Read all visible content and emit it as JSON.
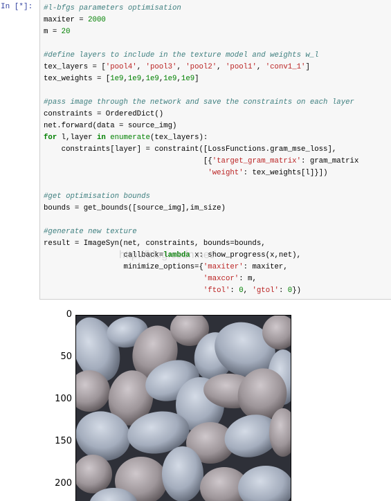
{
  "prompt": "In  [*]:",
  "watermark": "http://blog.csdn.net/",
  "code_lines": [
    [
      [
        "c",
        "#l-bfgs parameters optimisation"
      ]
    ],
    [
      [
        "p",
        "maxiter = "
      ],
      [
        "n",
        "2000"
      ]
    ],
    [
      [
        "p",
        "m = "
      ],
      [
        "n",
        "20"
      ]
    ],
    [],
    [
      [
        "c",
        "#define layers to include in the texture model and weights w_l"
      ]
    ],
    [
      [
        "p",
        "tex_layers = ["
      ],
      [
        "s",
        "'pool4'"
      ],
      [
        "p",
        ", "
      ],
      [
        "s",
        "'pool3'"
      ],
      [
        "p",
        ", "
      ],
      [
        "s",
        "'pool2'"
      ],
      [
        "p",
        ", "
      ],
      [
        "s",
        "'pool1'"
      ],
      [
        "p",
        ", "
      ],
      [
        "s",
        "'conv1_1'"
      ],
      [
        "p",
        "]"
      ]
    ],
    [
      [
        "p",
        "tex_weights = ["
      ],
      [
        "n",
        "1e9"
      ],
      [
        "p",
        ","
      ],
      [
        "n",
        "1e9"
      ],
      [
        "p",
        ","
      ],
      [
        "n",
        "1e9"
      ],
      [
        "p",
        ","
      ],
      [
        "n",
        "1e9"
      ],
      [
        "p",
        ","
      ],
      [
        "n",
        "1e9"
      ],
      [
        "p",
        "]"
      ]
    ],
    [],
    [
      [
        "c",
        "#pass image through the network and save the constraints on each layer"
      ]
    ],
    [
      [
        "p",
        "constraints = OrderedDict()"
      ]
    ],
    [
      [
        "p",
        "net.forward(data = source_img)"
      ]
    ],
    [
      [
        "k",
        "for"
      ],
      [
        "p",
        " l,layer "
      ],
      [
        "k",
        "in"
      ],
      [
        "p",
        " "
      ],
      [
        "n",
        "enumerate"
      ],
      [
        "p",
        "(tex_layers):"
      ]
    ],
    [
      [
        "p",
        "    constraints[layer] = constraint([LossFunctions.gram_mse_loss],"
      ]
    ],
    [
      [
        "p",
        "                                    [{"
      ],
      [
        "s",
        "'target_gram_matrix'"
      ],
      [
        "p",
        ": gram_matrix"
      ]
    ],
    [
      [
        "p",
        "                                     "
      ],
      [
        "s",
        "'weight'"
      ],
      [
        "p",
        ": tex_weights[l]}])"
      ]
    ],
    [],
    [
      [
        "c",
        "#get optimisation bounds"
      ]
    ],
    [
      [
        "p",
        "bounds = get_bounds([source_img],im_size)"
      ]
    ],
    [],
    [
      [
        "c",
        "#generate new texture"
      ]
    ],
    [
      [
        "p",
        "result = ImageSyn(net, constraints, bounds=bounds,"
      ]
    ],
    [
      [
        "p",
        "                  callback="
      ],
      [
        "k",
        "lambda"
      ],
      [
        "p",
        " x: show_progress(x,net),"
      ]
    ],
    [
      [
        "p",
        "                  minimize_options={"
      ],
      [
        "s",
        "'maxiter'"
      ],
      [
        "p",
        ": maxiter,"
      ]
    ],
    [
      [
        "p",
        "                                    "
      ],
      [
        "s",
        "'maxcor'"
      ],
      [
        "p",
        ": m,"
      ]
    ],
    [
      [
        "p",
        "                                    "
      ],
      [
        "s",
        "'ftol'"
      ],
      [
        "p",
        ": "
      ],
      [
        "n",
        "0"
      ],
      [
        "p",
        ", "
      ],
      [
        "s",
        "'gtol'"
      ],
      [
        "p",
        ": "
      ],
      [
        "n",
        "0"
      ],
      [
        "p",
        "})"
      ]
    ]
  ],
  "output_plot": {
    "type": "image",
    "y_ticks": [
      "0",
      "50",
      "100",
      "150",
      "200"
    ],
    "y_tick_values": [
      0,
      50,
      100,
      150,
      200
    ],
    "image_size": 256,
    "content": "generated pebble texture"
  }
}
